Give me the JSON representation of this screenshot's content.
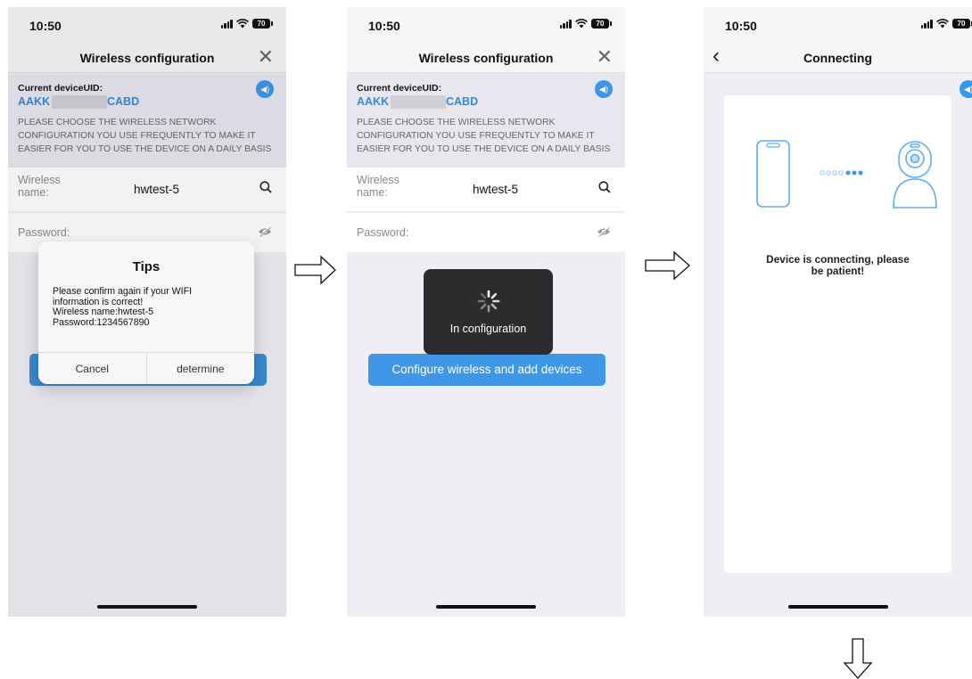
{
  "status": {
    "time": "10:50",
    "battery": "70"
  },
  "screen1": {
    "title": "Wireless configuration",
    "uid_label": "Current deviceUID:",
    "uid_prefix": "AAKK",
    "uid_suffix": "CABD",
    "description": "PLEASE CHOOSE THE WIRELESS NETWORK CONFIGURATION YOU USE FREQUENTLY TO MAKE IT EASIER FOR YOU TO USE THE DEVICE ON A DAILY BASIS",
    "wireless_label": "Wireless name:",
    "wireless_value": "hwtest-5",
    "password_label": "Password:",
    "dialog": {
      "title": "Tips",
      "body": "Please confirm again if your WIFI\ninformation is correct!\nWireless name:hwtest-5\nPassword:1234567890",
      "cancel": "Cancel",
      "confirm": "determine"
    }
  },
  "screen2": {
    "title": "Wireless configuration",
    "uid_label": "Current deviceUID:",
    "uid_prefix": "AAKK",
    "uid_suffix": "CABD",
    "description": "PLEASE CHOOSE THE WIRELESS NETWORK CONFIGURATION YOU USE FREQUENTLY TO MAKE IT EASIER FOR YOU TO USE THE DEVICE ON A DAILY BASIS",
    "wireless_label": "Wireless name:",
    "wireless_value": "hwtest-5",
    "password_label": "Password:",
    "loading_text": "In configuration",
    "configure_button": "Configure wireless and add devices"
  },
  "screen3": {
    "title": "Connecting",
    "message": "Device is connecting, please\nbe patient!"
  },
  "colors": {
    "accent": "#3f97e8",
    "uid_blue": "#2d8ce6",
    "background": "#efeef4"
  },
  "icons": [
    "signal-icon",
    "wifi-icon",
    "battery-icon",
    "close-icon",
    "speaker-icon",
    "search-icon",
    "eye-hidden-icon",
    "spinner-icon",
    "back-chevron-icon",
    "phone-icon",
    "camera-icon",
    "arrow-right-icon",
    "arrow-down-icon"
  ]
}
